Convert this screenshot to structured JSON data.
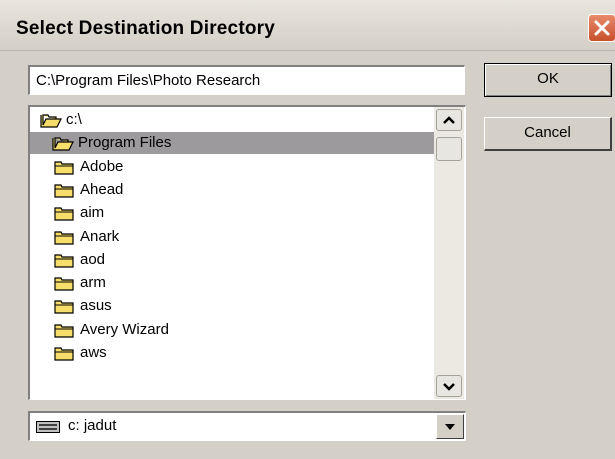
{
  "window": {
    "title": "Select Destination Directory"
  },
  "path_input": {
    "value": "C:\\Program Files\\Photo Research"
  },
  "buttons": {
    "ok": "OK",
    "cancel": "Cancel"
  },
  "directory_list": {
    "items": [
      {
        "label": "c:\\",
        "icon": "open-folder-icon",
        "selected": false
      },
      {
        "label": "Program Files",
        "icon": "open-folder-icon",
        "selected": true
      },
      {
        "label": "Adobe",
        "icon": "folder-icon",
        "selected": false
      },
      {
        "label": "Ahead",
        "icon": "folder-icon",
        "selected": false
      },
      {
        "label": "aim",
        "icon": "folder-icon",
        "selected": false
      },
      {
        "label": "Anark",
        "icon": "folder-icon",
        "selected": false
      },
      {
        "label": "aod",
        "icon": "folder-icon",
        "selected": false
      },
      {
        "label": "arm",
        "icon": "folder-icon",
        "selected": false
      },
      {
        "label": "asus",
        "icon": "folder-icon",
        "selected": false
      },
      {
        "label": "Avery Wizard",
        "icon": "folder-icon",
        "selected": false
      },
      {
        "label": "aws",
        "icon": "folder-icon",
        "selected": false
      }
    ]
  },
  "drive_select": {
    "value": "c: jadut",
    "icon": "drive-icon"
  },
  "colors": {
    "selection": "#9c9a9c",
    "folder": "#f7de6b",
    "close_button": "#c8502d"
  }
}
